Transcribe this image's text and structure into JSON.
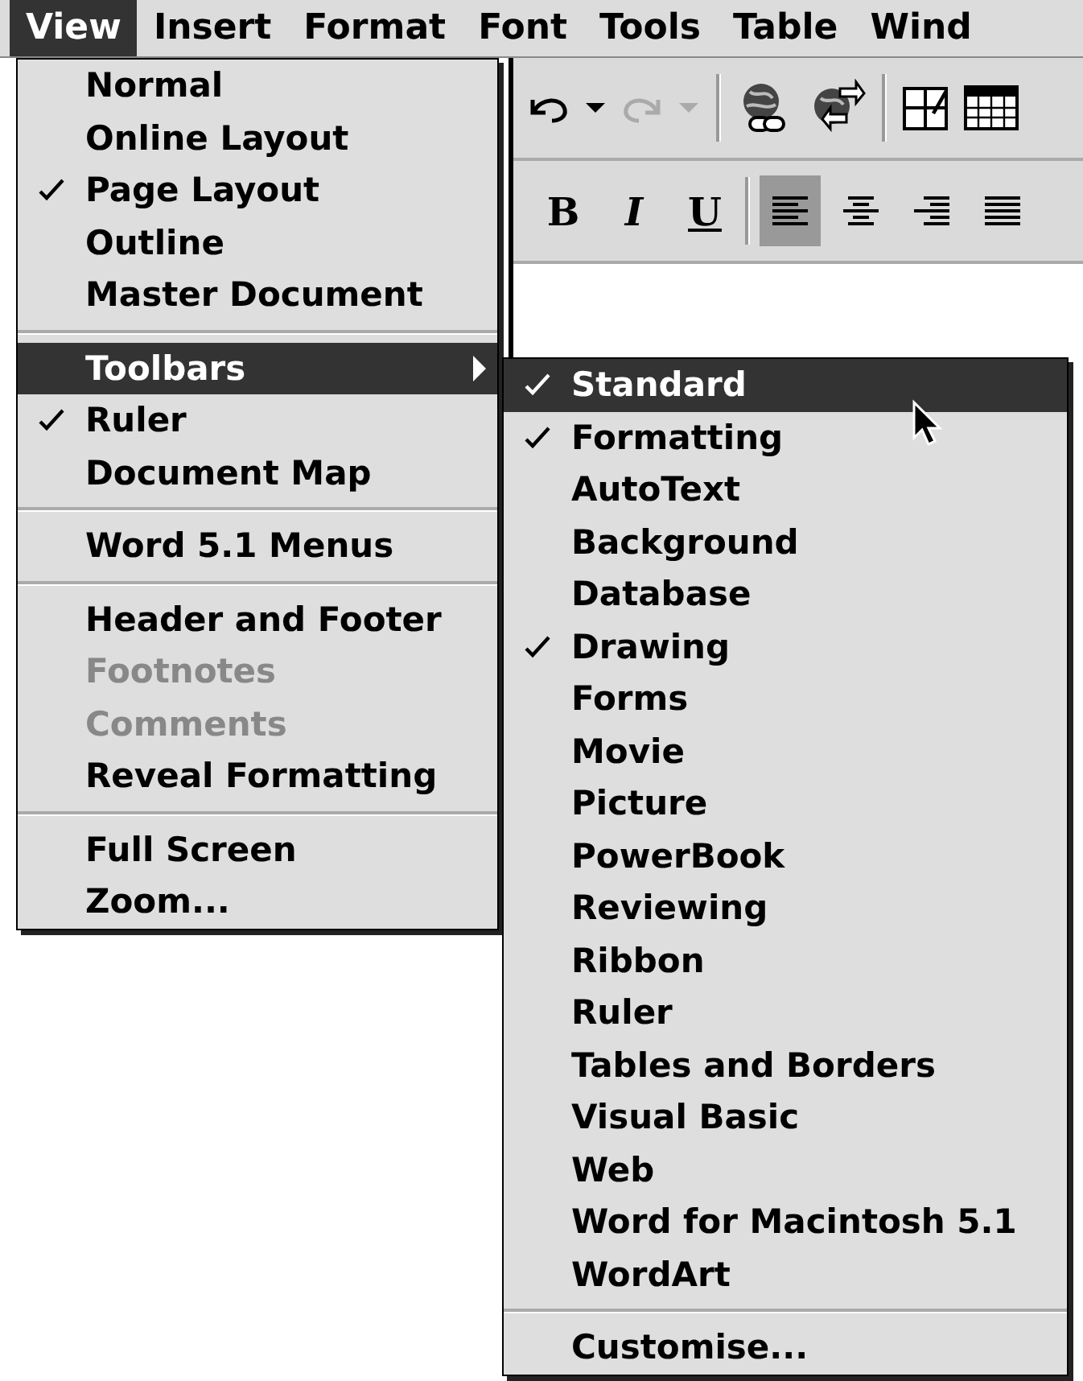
{
  "menubar": [
    {
      "label": "View",
      "selected": true
    },
    {
      "label": "Insert",
      "selected": false
    },
    {
      "label": "Format",
      "selected": false
    },
    {
      "label": "Font",
      "selected": false
    },
    {
      "label": "Tools",
      "selected": false
    },
    {
      "label": "Table",
      "selected": false
    },
    {
      "label": "Wind",
      "selected": false
    }
  ],
  "toolbars": {
    "standard": [
      [
        {
          "kind": "undo",
          "disabled": false
        },
        {
          "kind": "dropdown",
          "disabled": false
        },
        {
          "kind": "redo",
          "disabled": true
        },
        {
          "kind": "dropdown",
          "disabled": true
        }
      ],
      [
        {
          "kind": "hyperlink",
          "disabled": false
        },
        {
          "kind": "web",
          "disabled": false
        }
      ],
      [
        {
          "kind": "drawtable",
          "disabled": false
        },
        {
          "kind": "table",
          "disabled": false
        }
      ]
    ],
    "formatting": [
      [
        {
          "kind": "bold",
          "label": "B",
          "selected": false
        },
        {
          "kind": "italic",
          "label": "I",
          "selected": false
        },
        {
          "kind": "underline",
          "label": "U",
          "selected": false
        }
      ],
      [
        {
          "kind": "alignleft",
          "selected": true
        },
        {
          "kind": "aligncenter",
          "selected": false
        },
        {
          "kind": "alignright",
          "selected": false
        },
        {
          "kind": "justify",
          "selected": false
        }
      ]
    ]
  },
  "view_menu": {
    "groups": [
      [
        {
          "label": "Normal",
          "checked": false,
          "selected": false,
          "disabled": false,
          "submenu": false
        },
        {
          "label": "Online Layout",
          "checked": false,
          "selected": false,
          "disabled": false,
          "submenu": false
        },
        {
          "label": "Page Layout",
          "checked": true,
          "selected": false,
          "disabled": false,
          "submenu": false
        },
        {
          "label": "Outline",
          "checked": false,
          "selected": false,
          "disabled": false,
          "submenu": false
        },
        {
          "label": "Master Document",
          "checked": false,
          "selected": false,
          "disabled": false,
          "submenu": false
        }
      ],
      [
        {
          "label": "Toolbars",
          "checked": false,
          "selected": true,
          "disabled": false,
          "submenu": true
        },
        {
          "label": "Ruler",
          "checked": true,
          "selected": false,
          "disabled": false,
          "submenu": false
        },
        {
          "label": "Document Map",
          "checked": false,
          "selected": false,
          "disabled": false,
          "submenu": false
        }
      ],
      [
        {
          "label": "Word 5.1 Menus",
          "checked": false,
          "selected": false,
          "disabled": false,
          "submenu": false
        }
      ],
      [
        {
          "label": "Header and Footer",
          "checked": false,
          "selected": false,
          "disabled": false,
          "submenu": false
        },
        {
          "label": "Footnotes",
          "checked": false,
          "selected": false,
          "disabled": true,
          "submenu": false
        },
        {
          "label": "Comments",
          "checked": false,
          "selected": false,
          "disabled": true,
          "submenu": false
        },
        {
          "label": "Reveal Formatting",
          "checked": false,
          "selected": false,
          "disabled": false,
          "submenu": false
        }
      ],
      [
        {
          "label": "Full Screen",
          "checked": false,
          "selected": false,
          "disabled": false,
          "submenu": false
        },
        {
          "label": "Zoom...",
          "checked": false,
          "selected": false,
          "disabled": false,
          "submenu": false
        }
      ]
    ]
  },
  "toolbars_menu": {
    "groups": [
      [
        {
          "label": "Standard",
          "checked": true,
          "selected": true,
          "disabled": false,
          "submenu": false
        },
        {
          "label": "Formatting",
          "checked": true,
          "selected": false,
          "disabled": false,
          "submenu": false
        },
        {
          "label": "AutoText",
          "checked": false,
          "selected": false,
          "disabled": false,
          "submenu": false
        },
        {
          "label": "Background",
          "checked": false,
          "selected": false,
          "disabled": false,
          "submenu": false
        },
        {
          "label": "Database",
          "checked": false,
          "selected": false,
          "disabled": false,
          "submenu": false
        },
        {
          "label": "Drawing",
          "checked": true,
          "selected": false,
          "disabled": false,
          "submenu": false
        },
        {
          "label": "Forms",
          "checked": false,
          "selected": false,
          "disabled": false,
          "submenu": false
        },
        {
          "label": "Movie",
          "checked": false,
          "selected": false,
          "disabled": false,
          "submenu": false
        },
        {
          "label": "Picture",
          "checked": false,
          "selected": false,
          "disabled": false,
          "submenu": false
        },
        {
          "label": "PowerBook",
          "checked": false,
          "selected": false,
          "disabled": false,
          "submenu": false
        },
        {
          "label": "Reviewing",
          "checked": false,
          "selected": false,
          "disabled": false,
          "submenu": false
        },
        {
          "label": "Ribbon",
          "checked": false,
          "selected": false,
          "disabled": false,
          "submenu": false
        },
        {
          "label": "Ruler",
          "checked": false,
          "selected": false,
          "disabled": false,
          "submenu": false
        },
        {
          "label": "Tables and Borders",
          "checked": false,
          "selected": false,
          "disabled": false,
          "submenu": false
        },
        {
          "label": "Visual Basic",
          "checked": false,
          "selected": false,
          "disabled": false,
          "submenu": false
        },
        {
          "label": "Web",
          "checked": false,
          "selected": false,
          "disabled": false,
          "submenu": false
        },
        {
          "label": "Word for Macintosh 5.1",
          "checked": false,
          "selected": false,
          "disabled": false,
          "submenu": false
        },
        {
          "label": "WordArt",
          "checked": false,
          "selected": false,
          "disabled": false,
          "submenu": false
        }
      ],
      [
        {
          "label": "Customise...",
          "checked": false,
          "selected": false,
          "disabled": false,
          "submenu": false
        }
      ]
    ]
  }
}
